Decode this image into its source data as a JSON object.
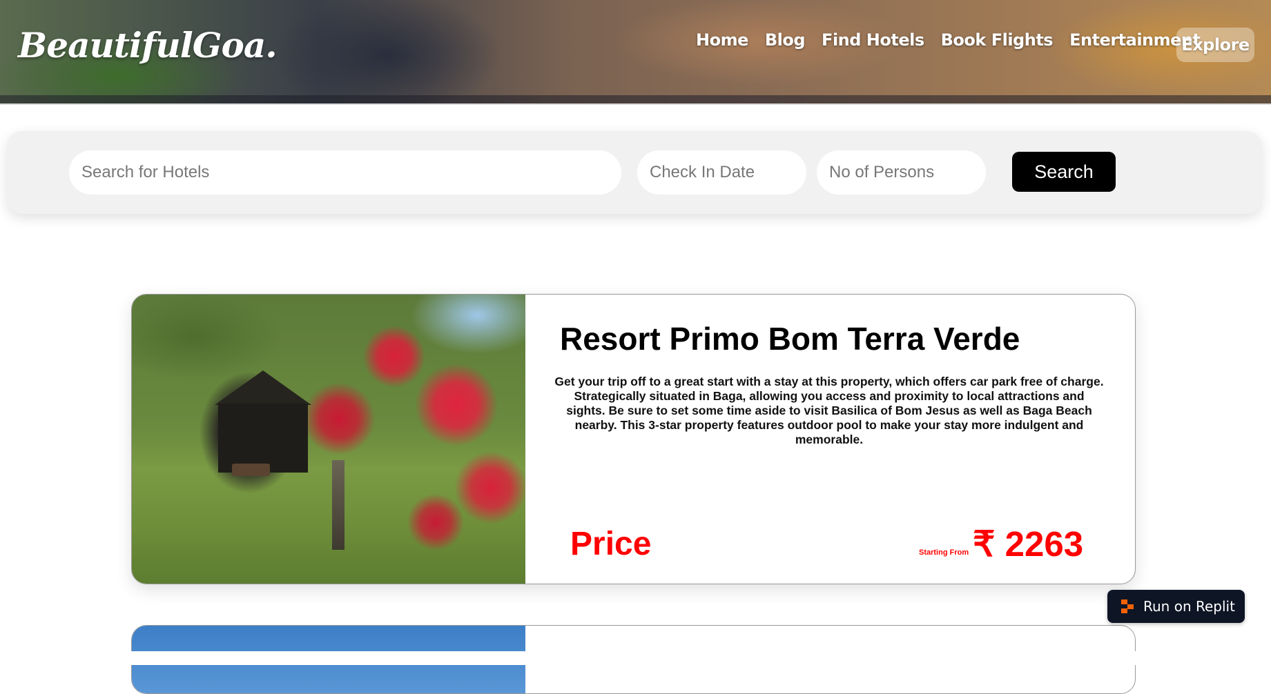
{
  "header": {
    "logo": "BeautifulGoa.",
    "nav": [
      "Home",
      "Blog",
      "Find Hotels",
      "Book Flights",
      "Entertainment"
    ],
    "explore": "Explore"
  },
  "search": {
    "hotel_placeholder": "Search for Hotels",
    "date_placeholder": "Check In Date",
    "persons_placeholder": "No of Persons",
    "button": "Search"
  },
  "hotels": [
    {
      "name": "Resort Primo Bom Terra Verde",
      "description": "Get your trip off to a great start with a stay at this property, which offers car park free of charge. Strategically situated in Baga, allowing you access and proximity to local attractions and sights. Be sure to set some time aside to visit Basilica of Bom Jesus as well as Baga Beach nearby. This 3-star property features outdoor pool to make your stay more indulgent and memorable.",
      "price_label": "Price",
      "price_prefix": "Starting From",
      "price": "₹ 2263"
    }
  ],
  "replit": {
    "label": "Run on Replit"
  },
  "colors": {
    "price": "#ff0000",
    "search_button": "#000000",
    "replit_bg": "#0e1525",
    "replit_accent": "#f26207"
  }
}
